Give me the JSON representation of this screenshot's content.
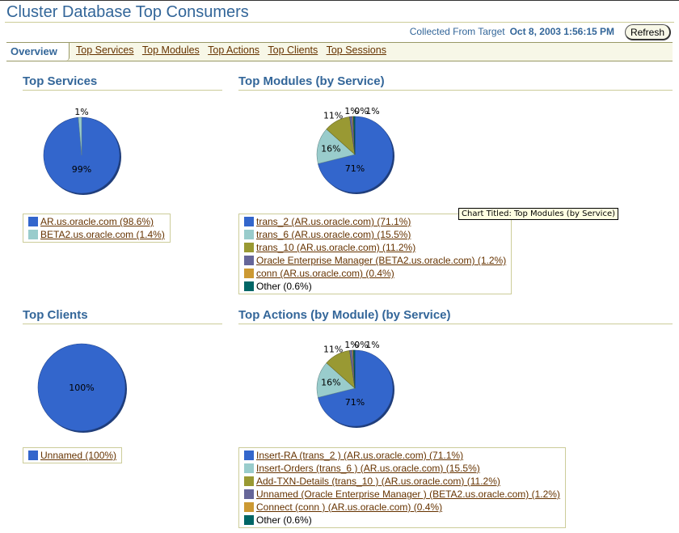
{
  "header": {
    "title": "Cluster Database Top Consumers",
    "collected_label": "Collected From Target",
    "collected_timestamp": "Oct 8, 2003 1:56:15 PM",
    "refresh_label": "Refresh"
  },
  "tabs": {
    "active": "Overview",
    "links": [
      "Top Services",
      "Top Modules",
      "Top Actions",
      "Top Clients",
      "Top Sessions"
    ]
  },
  "tooltip": "Chart Titled: Top Modules (by Service)",
  "colors": {
    "blue": "#3366cc",
    "lightteal": "#99cccc",
    "olive": "#999933",
    "purple": "#666699",
    "orange": "#cc9933",
    "darkteal": "#006666"
  },
  "chart_data": [
    {
      "id": "top-services",
      "type": "pie",
      "title": "Top Services",
      "slices": [
        {
          "label": "AR.us.oracle.com",
          "value": 98.6,
          "pie_label": "99%",
          "color": "#3366cc",
          "link": true
        },
        {
          "label": "BETA2.us.oracle.com",
          "value": 1.4,
          "pie_label": "1%",
          "color": "#99cccc",
          "link": true
        }
      ],
      "legend": [
        "AR.us.oracle.com (98.6%)",
        "BETA2.us.oracle.com (1.4%)"
      ]
    },
    {
      "id": "top-modules",
      "type": "pie",
      "title": "Top Modules (by Service)",
      "slices": [
        {
          "label": "trans_2 (AR.us.oracle.com)",
          "value": 71.1,
          "pie_label": "71%",
          "color": "#3366cc",
          "link": true
        },
        {
          "label": "trans_6 (AR.us.oracle.com)",
          "value": 15.5,
          "pie_label": "16%",
          "color": "#99cccc",
          "link": true
        },
        {
          "label": "trans_10 (AR.us.oracle.com)",
          "value": 11.2,
          "pie_label": "11%",
          "color": "#999933",
          "link": true
        },
        {
          "label": "Oracle Enterprise Manager (BETA2.us.oracle.com)",
          "value": 1.2,
          "pie_label": "1%",
          "color": "#666699",
          "link": true
        },
        {
          "label": "conn (AR.us.oracle.com)",
          "value": 0.4,
          "pie_label": "0%",
          "color": "#cc9933",
          "link": true
        },
        {
          "label": "Other",
          "value": 0.6,
          "pie_label": "1%",
          "color": "#006666",
          "link": false
        }
      ],
      "legend": [
        "trans_2 (AR.us.oracle.com) (71.1%)",
        "trans_6 (AR.us.oracle.com) (15.5%)",
        "trans_10 (AR.us.oracle.com) (11.2%)",
        "Oracle Enterprise Manager (BETA2.us.oracle.com) (1.2%)",
        "conn (AR.us.oracle.com) (0.4%)",
        "Other (0.6%)"
      ]
    },
    {
      "id": "top-clients",
      "type": "pie",
      "title": "Top Clients",
      "slices": [
        {
          "label": "Unnamed",
          "value": 100,
          "pie_label": "100%",
          "color": "#3366cc",
          "link": true
        }
      ],
      "legend": [
        "Unnamed (100%)"
      ]
    },
    {
      "id": "top-actions",
      "type": "pie",
      "title": "Top Actions (by Module) (by Service)",
      "slices": [
        {
          "label": "Insert-RA (trans_2 ) (AR.us.oracle.com)",
          "value": 71.1,
          "pie_label": "71%",
          "color": "#3366cc",
          "link": true
        },
        {
          "label": "Insert-Orders (trans_6 ) (AR.us.oracle.com)",
          "value": 15.5,
          "pie_label": "16%",
          "color": "#99cccc",
          "link": true
        },
        {
          "label": "Add-TXN-Details (trans_10 ) (AR.us.oracle.com)",
          "value": 11.2,
          "pie_label": "11%",
          "color": "#999933",
          "link": true
        },
        {
          "label": "Unnamed (Oracle Enterprise Manager ) (BETA2.us.oracle.com)",
          "value": 1.2,
          "pie_label": "1%",
          "color": "#666699",
          "link": true
        },
        {
          "label": "Connect (conn ) (AR.us.oracle.com)",
          "value": 0.4,
          "pie_label": "0%",
          "color": "#cc9933",
          "link": true
        },
        {
          "label": "Other",
          "value": 0.6,
          "pie_label": "1%",
          "color": "#006666",
          "link": false
        }
      ],
      "legend": [
        "Insert-RA (trans_2 ) (AR.us.oracle.com) (71.1%)",
        "Insert-Orders (trans_6 ) (AR.us.oracle.com) (15.5%)",
        "Add-TXN-Details (trans_10 ) (AR.us.oracle.com) (11.2%)",
        "Unnamed (Oracle Enterprise Manager ) (BETA2.us.oracle.com) (1.2%)",
        "Connect (conn ) (AR.us.oracle.com) (0.4%)",
        "Other (0.6%)"
      ]
    }
  ]
}
